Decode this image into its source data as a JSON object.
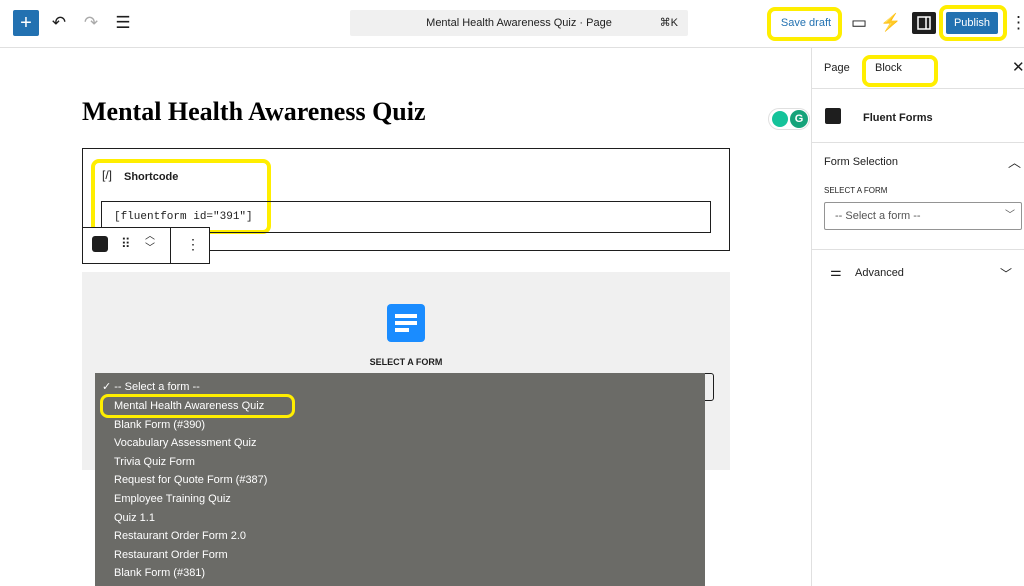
{
  "toolbar": {
    "add_icon": "plus-icon",
    "undo_icon": "undo-icon",
    "redo_icon": "redo-icon",
    "outline_icon": "list-view-icon",
    "document_title": "Mental Health Awareness Quiz · Page",
    "shortcut": "⌘K",
    "save_draft_label": "Save draft",
    "publish_label": "Publish"
  },
  "editor": {
    "page_title": "Mental Health Awareness Quiz",
    "shortcode_block": {
      "icon": "[/]",
      "label": "Shortcode",
      "value": "[fluentform id=\"391\"]"
    },
    "fluent_block": {
      "select_label": "SELECT A FORM"
    },
    "dropdown": {
      "selected_item": "✓ -- Select a form --",
      "options": [
        "Mental Health Awareness Quiz",
        "Blank Form (#390)",
        "Vocabulary Assessment Quiz",
        "Trivia Quiz Form",
        "Request for Quote Form (#387)",
        "Employee Training Quiz",
        "Quiz 1.1",
        "Restaurant Order Form 2.0",
        "Restaurant Order Form",
        "Blank Form (#381)"
      ]
    }
  },
  "sidebar": {
    "tabs": [
      "Page",
      "Block"
    ],
    "block_name": "Fluent Forms",
    "section_title": "Form Selection",
    "select_label": "SELECT A FORM",
    "select_value": "-- Select a form --",
    "advanced_label": "Advanced"
  },
  "colors": {
    "accent": "#2271b1",
    "highlight": "#ffee00",
    "dropdown_bg": "#6b6b67",
    "fluent_blue": "#1a8cff"
  }
}
